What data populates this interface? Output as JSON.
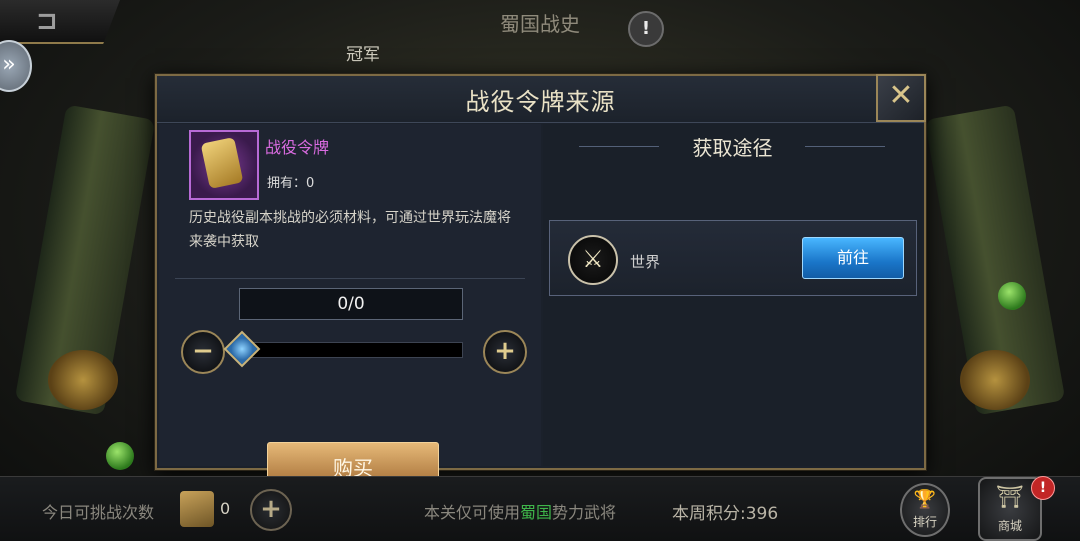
{
  "top": {
    "back_icon": "back-arrow-icon",
    "title": "蜀国战史",
    "info_icon": "exclamation-icon",
    "info_symbol": "!",
    "sub_label": "冠军",
    "side_arrow_symbol": "»"
  },
  "dialog": {
    "title": "战役令牌来源",
    "close_symbol": "✕",
    "item": {
      "name": "战役令牌",
      "own_label": "拥有：0",
      "description": "历史战役副本挑战的必须材料，可通过世界玩法魔将来袭中获取"
    },
    "quantity": {
      "display": "0/0",
      "value": 0,
      "max": 0,
      "minus_symbol": "−",
      "plus_symbol": "+"
    },
    "buy_label": "购买",
    "routes": {
      "title": "获取途径",
      "items": [
        {
          "icon": "crossed-swords-icon",
          "symbol": "⚔",
          "name": "世界",
          "button_label": "前往"
        }
      ]
    }
  },
  "bottom": {
    "daily_label": "今日可挑战次数",
    "daily_count": "0",
    "plus_symbol": "+",
    "notice_prefix": "本关仅可使用",
    "notice_highlight": "蜀国",
    "notice_suffix": "势力武将",
    "weekly_score": "本周积分:396",
    "rank_label": "排行",
    "shop_label": "商城",
    "shop_alert": "!"
  },
  "colors": {
    "item_name": "#d96be0",
    "highlight_green": "#3fb54a",
    "goto_blue": "#1a76c9",
    "buy_gold": "#c8945a"
  }
}
